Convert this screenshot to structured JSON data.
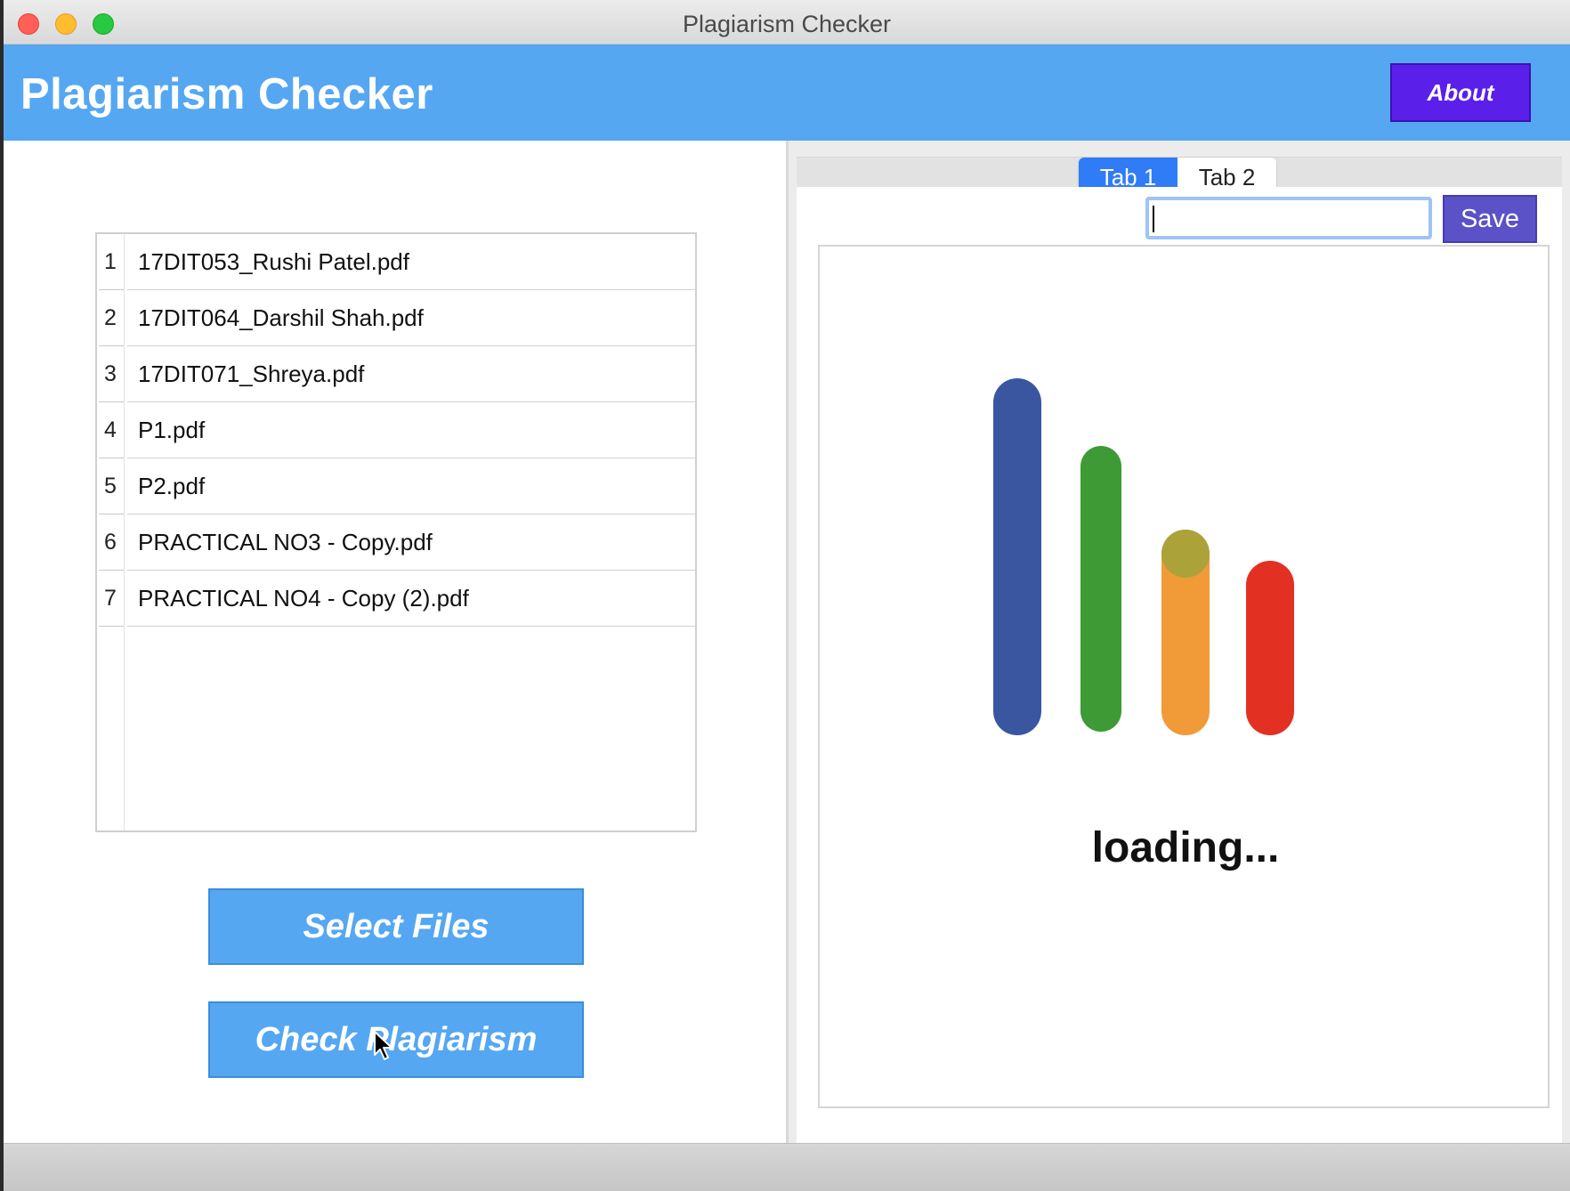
{
  "window": {
    "title": "Plagiarism Checker"
  },
  "header": {
    "title": "Plagiarism Checker",
    "about_label": "About"
  },
  "files": [
    {
      "num": "1",
      "name": "17DIT053_Rushi Patel.pdf"
    },
    {
      "num": "2",
      "name": "17DIT064_Darshil Shah.pdf"
    },
    {
      "num": "3",
      "name": "17DIT071_Shreya.pdf"
    },
    {
      "num": "4",
      "name": "P1.pdf"
    },
    {
      "num": "5",
      "name": "P2.pdf"
    },
    {
      "num": "6",
      "name": "PRACTICAL NO3 - Copy.pdf"
    },
    {
      "num": "7",
      "name": "PRACTICAL NO4 - Copy (2).pdf"
    }
  ],
  "buttons": {
    "select_files": "Select Files",
    "check_plagiarism": "Check Plagiarism"
  },
  "tabs": [
    {
      "label": "Tab 1",
      "active": true
    },
    {
      "label": "Tab 2",
      "active": false
    }
  ],
  "save": {
    "input_value": "",
    "label": "Save"
  },
  "loader": {
    "text": "loading...",
    "colors": {
      "blue": "#3a56a0",
      "green": "#3d9a35",
      "orange": "#f19a38",
      "olive": "#aca23a",
      "red": "#e23122"
    }
  },
  "colors": {
    "header": "#55a7f2",
    "about": "#5a1fe8",
    "save": "#5b52c8",
    "tab_active": "#2f7cf6"
  }
}
